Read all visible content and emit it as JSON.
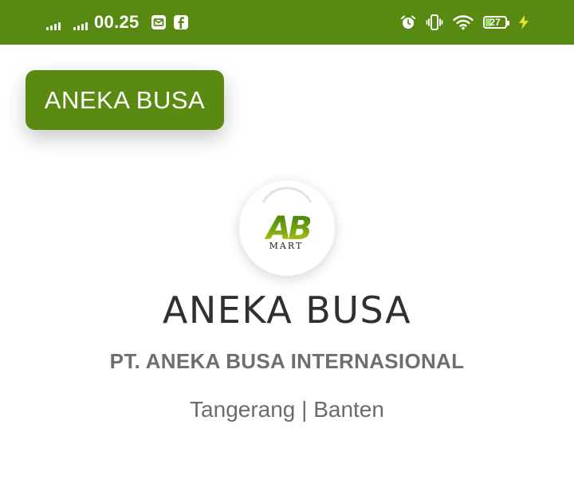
{
  "status_bar": {
    "time": "00.25",
    "battery_level": "27",
    "battery_fraction": 0.27,
    "icons": [
      "signal-icon",
      "signal-icon",
      "mail-app-icon",
      "facebook-icon",
      "alarm-icon",
      "vibrate-icon",
      "wifi-icon",
      "battery-icon",
      "charging-icon"
    ],
    "color": "#588a12"
  },
  "header": {
    "brand_label": "ANEKA BUSA",
    "color": "#5a8a12"
  },
  "logo": {
    "monogram": "AB",
    "subtitle": "MART"
  },
  "company": {
    "name": "ANEKA BUSA",
    "legal_name": "PT. ANEKA BUSA INTERNASIONAL",
    "location": "Tangerang | Banten"
  }
}
